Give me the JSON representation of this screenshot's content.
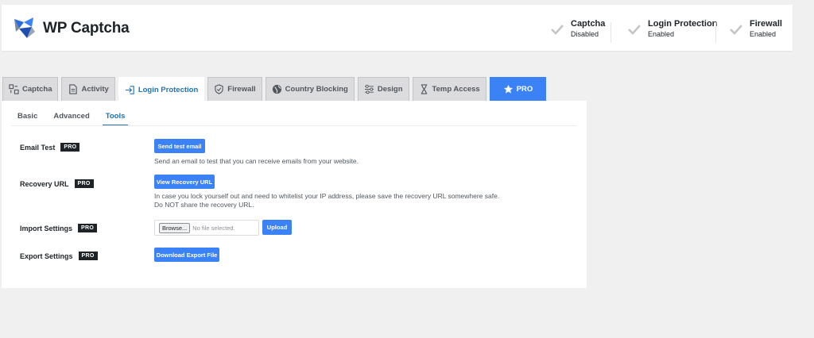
{
  "header": {
    "logo_text": "WP Captcha",
    "statuses": [
      {
        "title": "Captcha",
        "value": "Disabled"
      },
      {
        "title": "Login Protection",
        "value": "Enabled"
      },
      {
        "title": "Firewall",
        "value": "Enabled"
      }
    ]
  },
  "tabs": [
    {
      "label": "Captcha",
      "icon": "captcha-icon"
    },
    {
      "label": "Activity",
      "icon": "document-icon"
    },
    {
      "label": "Login Protection",
      "icon": "login-icon"
    },
    {
      "label": "Firewall",
      "icon": "shield-icon"
    },
    {
      "label": "Country Blocking",
      "icon": "globe-icon"
    },
    {
      "label": "Design",
      "icon": "sliders-icon"
    },
    {
      "label": "Temp Access",
      "icon": "hourglass-icon"
    },
    {
      "label": "PRO",
      "icon": "star-icon"
    }
  ],
  "subtabs": [
    "Basic",
    "Advanced",
    "Tools"
  ],
  "pro_badge": "PRO",
  "tools": {
    "email_test": {
      "label": "Email Test",
      "button": "Send test email",
      "description": "Send an email to test that you can receive emails from your website."
    },
    "recovery_url": {
      "label": "Recovery URL",
      "button": "View Recovery URL",
      "description_line1": "In case you lock yourself out and need to whitelist your IP address, please save the recovery URL somewhere safe.",
      "description_line2": "Do NOT share the recovery URL."
    },
    "import_settings": {
      "label": "Import Settings",
      "browse": "Browse...",
      "no_file": "No file selected.",
      "button": "Upload"
    },
    "export_settings": {
      "label": "Export Settings",
      "button": "Download Export File"
    }
  },
  "colors": {
    "accent": "#3b82f6",
    "active_tab_text": "#2271b1",
    "badge_bg": "#1d2327"
  }
}
